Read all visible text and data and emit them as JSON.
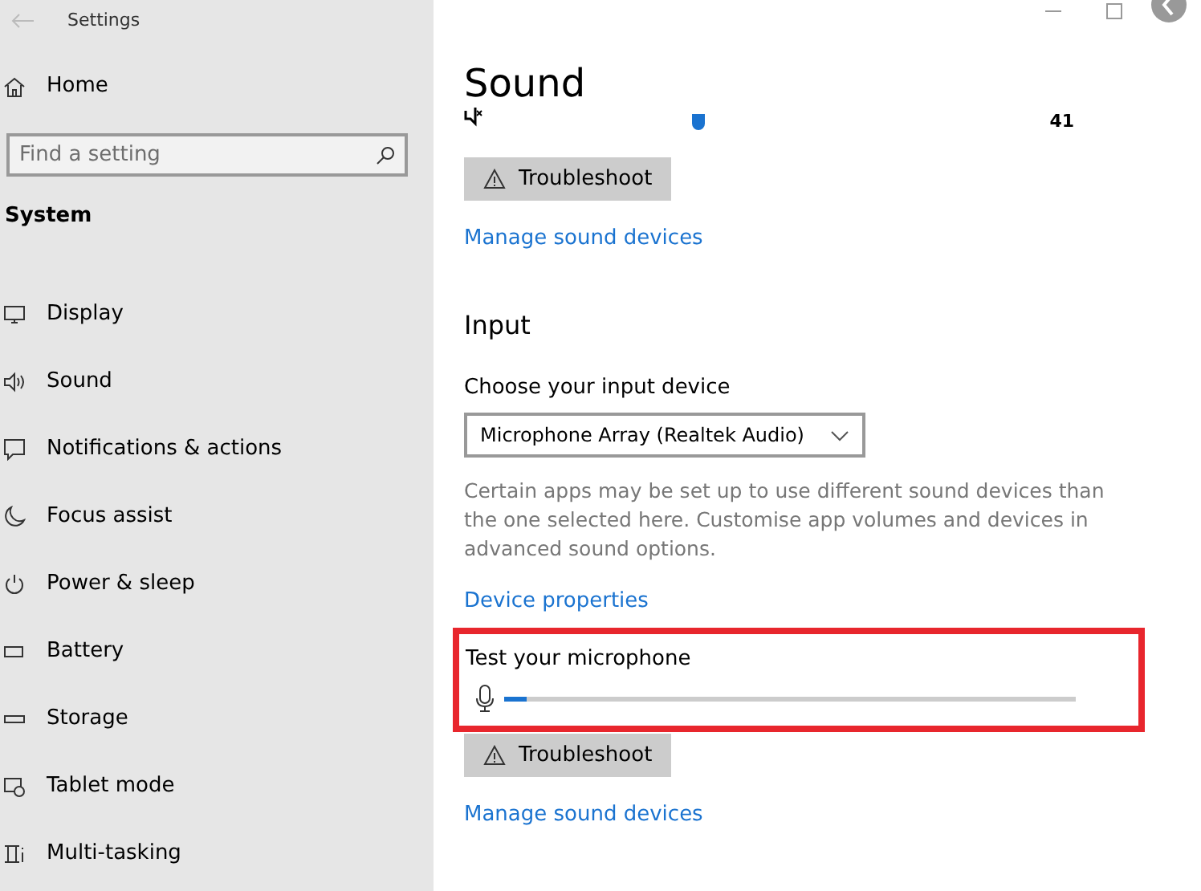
{
  "window": {
    "title": "Settings"
  },
  "sidebar": {
    "home": "Home",
    "search": {
      "placeholder": "Find a setting"
    },
    "section": "System",
    "items": [
      {
        "label": "Display",
        "kind": "display"
      },
      {
        "label": "Sound",
        "kind": "sound"
      },
      {
        "label": "Notifications & actions",
        "kind": "notifications"
      },
      {
        "label": "Focus assist",
        "kind": "focus"
      },
      {
        "label": "Power & sleep",
        "kind": "power"
      },
      {
        "label": "Battery",
        "kind": "battery"
      },
      {
        "label": "Storage",
        "kind": "storage"
      },
      {
        "label": "Tablet mode",
        "kind": "tablet"
      },
      {
        "label": "Multi-tasking",
        "kind": "multitask"
      }
    ]
  },
  "page": {
    "title": "Sound",
    "output": {
      "volume": {
        "reading": "41"
      },
      "troubleshoot": "Troubleshoot",
      "manage_link": "Manage sound devices"
    },
    "input": {
      "heading": "Input",
      "device_label": "Choose your input device",
      "device": "Microphone Array (Realtek Audio)",
      "description": "Certain apps may be set up to use different sound devices than the one selected here. Customise app volumes and devices in advanced sound options.",
      "properties_link": "Device properties",
      "test": {
        "label": "Test your microphone",
        "level": 0.04,
        "highlighted": true
      },
      "troubleshoot": "Troubleshoot",
      "manage_link": "Manage sound devices"
    }
  }
}
